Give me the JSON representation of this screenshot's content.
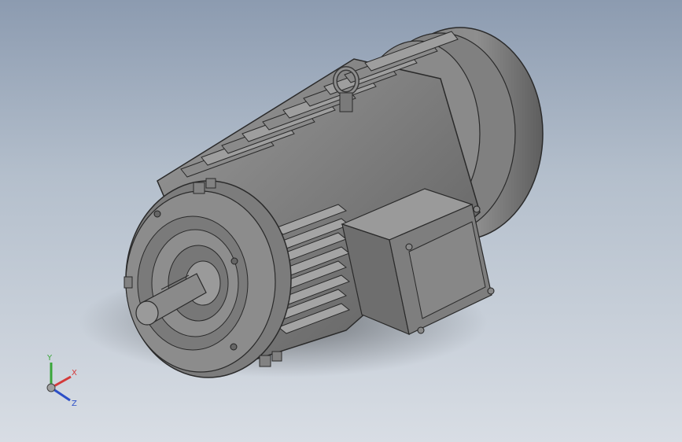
{
  "viewport": {
    "background_top": "#8c9bb0",
    "background_bottom": "#d8dde4"
  },
  "model": {
    "body_color": "#6e6e6e",
    "face_color": "#8a8a8a",
    "edge_color": "#2a2a2a"
  },
  "triad": {
    "x_label": "X",
    "y_label": "Y",
    "z_label": "Z",
    "x_color": "#d43a3a",
    "y_color": "#3aa63a",
    "z_color": "#2c4fc7"
  }
}
